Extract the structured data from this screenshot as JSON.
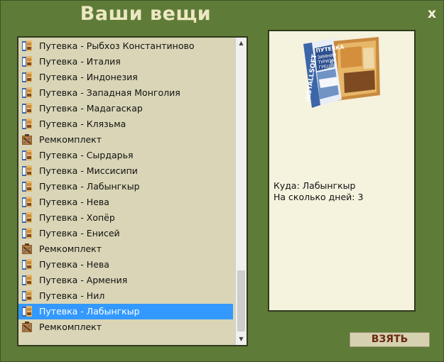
{
  "window": {
    "title": "Ваши вещи",
    "close_label": "x"
  },
  "list": {
    "items": [
      {
        "label": "Путевка - Рыбхоз Константиново",
        "icon": "voucher-icon",
        "selected": false
      },
      {
        "label": "Путевка - Италия",
        "icon": "voucher-icon",
        "selected": false
      },
      {
        "label": "Путевка - Индонезия",
        "icon": "voucher-icon",
        "selected": false
      },
      {
        "label": "Путевка - Западная Монголия",
        "icon": "voucher-icon",
        "selected": false
      },
      {
        "label": "Путевка - Мадагаскар",
        "icon": "voucher-icon",
        "selected": false
      },
      {
        "label": "Путевка - Клязьма",
        "icon": "voucher-icon",
        "selected": false
      },
      {
        "label": "Ремкомплект",
        "icon": "repair-kit-icon",
        "selected": false
      },
      {
        "label": "Путевка - Сырдарья",
        "icon": "voucher-icon",
        "selected": false
      },
      {
        "label": "Путевка - Миссисипи",
        "icon": "voucher-icon",
        "selected": false
      },
      {
        "label": "Путевка - Лабынгкыр",
        "icon": "voucher-icon",
        "selected": false
      },
      {
        "label": "Путевка - Нева",
        "icon": "voucher-icon",
        "selected": false
      },
      {
        "label": "Путевка - Хопёр",
        "icon": "voucher-icon",
        "selected": false
      },
      {
        "label": "Путевка - Енисей",
        "icon": "voucher-icon",
        "selected": false
      },
      {
        "label": "Ремкомплект",
        "icon": "repair-kit-icon",
        "selected": false
      },
      {
        "label": "Путевка - Нева",
        "icon": "voucher-icon",
        "selected": false
      },
      {
        "label": "Путевка - Армения",
        "icon": "voucher-icon",
        "selected": false
      },
      {
        "label": "Путевка - Нил",
        "icon": "voucher-icon",
        "selected": false
      },
      {
        "label": "Путевка - Лабынгкыр",
        "icon": "voucher-icon",
        "selected": true
      },
      {
        "label": "Ремкомплект",
        "icon": "repair-kit-icon",
        "selected": false
      }
    ]
  },
  "detail": {
    "image": "travel-brochure-image",
    "brochure_lines": [
      "INSTALLSOFT",
      "ПУТЕВКА",
      "ЗИМНИЙ",
      "ТУРИЗМ",
      "В",
      "ГРЕЦИИ"
    ],
    "destination": "Куда: Лабынгкыр",
    "days": "На сколько дней: 3"
  },
  "actions": {
    "take_label": "ВЗЯТЬ"
  },
  "colors": {
    "background": "#5f7b38",
    "list_bg": "#d9d5b6",
    "detail_bg": "#f5f2de",
    "selection": "#3399ff",
    "button_text": "#6a2a10"
  }
}
